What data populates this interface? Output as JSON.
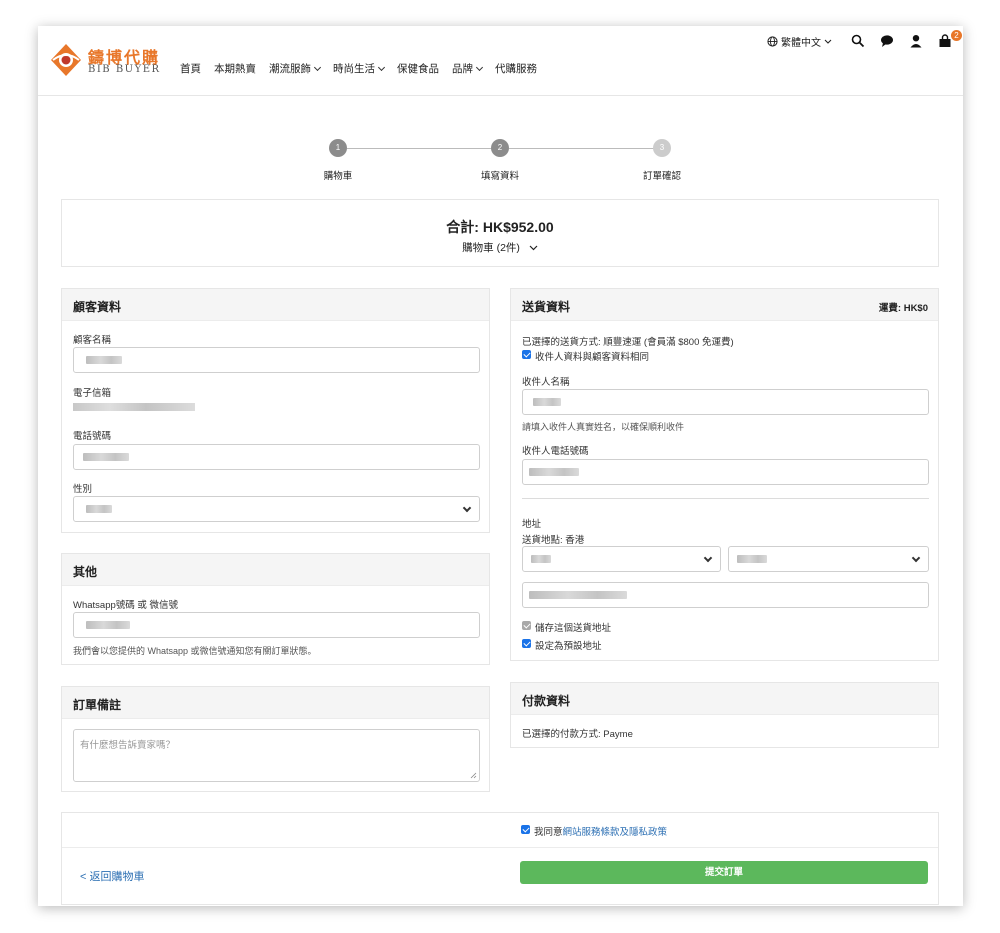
{
  "header": {
    "logo_cn": "鑄博代購",
    "logo_en": "BIB BUYER",
    "nav": [
      {
        "label": "首頁",
        "dropdown": false
      },
      {
        "label": "本期熱賣",
        "dropdown": false
      },
      {
        "label": "潮流服飾",
        "dropdown": true
      },
      {
        "label": "時尚生活",
        "dropdown": true
      },
      {
        "label": "保健食品",
        "dropdown": false
      },
      {
        "label": "品牌",
        "dropdown": true
      },
      {
        "label": "代購服務",
        "dropdown": false
      }
    ],
    "language": "繁體中文",
    "cart_count": "2"
  },
  "stepper": {
    "steps": [
      {
        "num": "1",
        "label": "購物車"
      },
      {
        "num": "2",
        "label": "填寫資料"
      },
      {
        "num": "3",
        "label": "訂單確認"
      }
    ]
  },
  "summary": {
    "total": "合計: HK$952.00",
    "cart": "購物車 (2件)"
  },
  "customer": {
    "title": "顧客資料",
    "name_label": "顧客名稱",
    "email_label": "電子信箱",
    "phone_label": "電話號碼",
    "gender_label": "性別"
  },
  "other": {
    "title": "其他",
    "whatsapp_label": "Whatsapp號碼 或 微信號",
    "whatsapp_help": "我們會以您提供的 Whatsapp 或微信號通知您有關訂單狀態。"
  },
  "notes": {
    "title": "訂單備註",
    "placeholder": "有什麼想告訴賣家嗎？"
  },
  "delivery": {
    "title": "送貨資料",
    "fee": "運費: HK$0",
    "method": "已選擇的送貨方式: 順豐速運 (會員滿 $800 免運費)",
    "same_as_customer": "收件人資料與顧客資料相同",
    "recipient_name_label": "收件人名稱",
    "recipient_name_help": "請填入收件人真實姓名，以確保順利收件",
    "recipient_phone_label": "收件人電話號碼",
    "address_label": "地址",
    "location": "送貨地點: 香港",
    "save_address": "儲存這個送貨地址",
    "set_default": "設定為預設地址"
  },
  "payment": {
    "title": "付款資料",
    "method": "已選擇的付款方式: Payme"
  },
  "footer": {
    "agree_prefix": "我同意",
    "agree_link": "網站服務條款及隱私政策",
    "back": "< 返回購物車",
    "submit": "提交訂單"
  },
  "colors": {
    "brand_orange": "#e8772a",
    "submit_green": "#5cb85c",
    "link_blue": "#2c6fb3",
    "checkbox_blue": "#1a73e8",
    "step_active": "#8c8c8c",
    "step_inactive": "#cccccc"
  }
}
